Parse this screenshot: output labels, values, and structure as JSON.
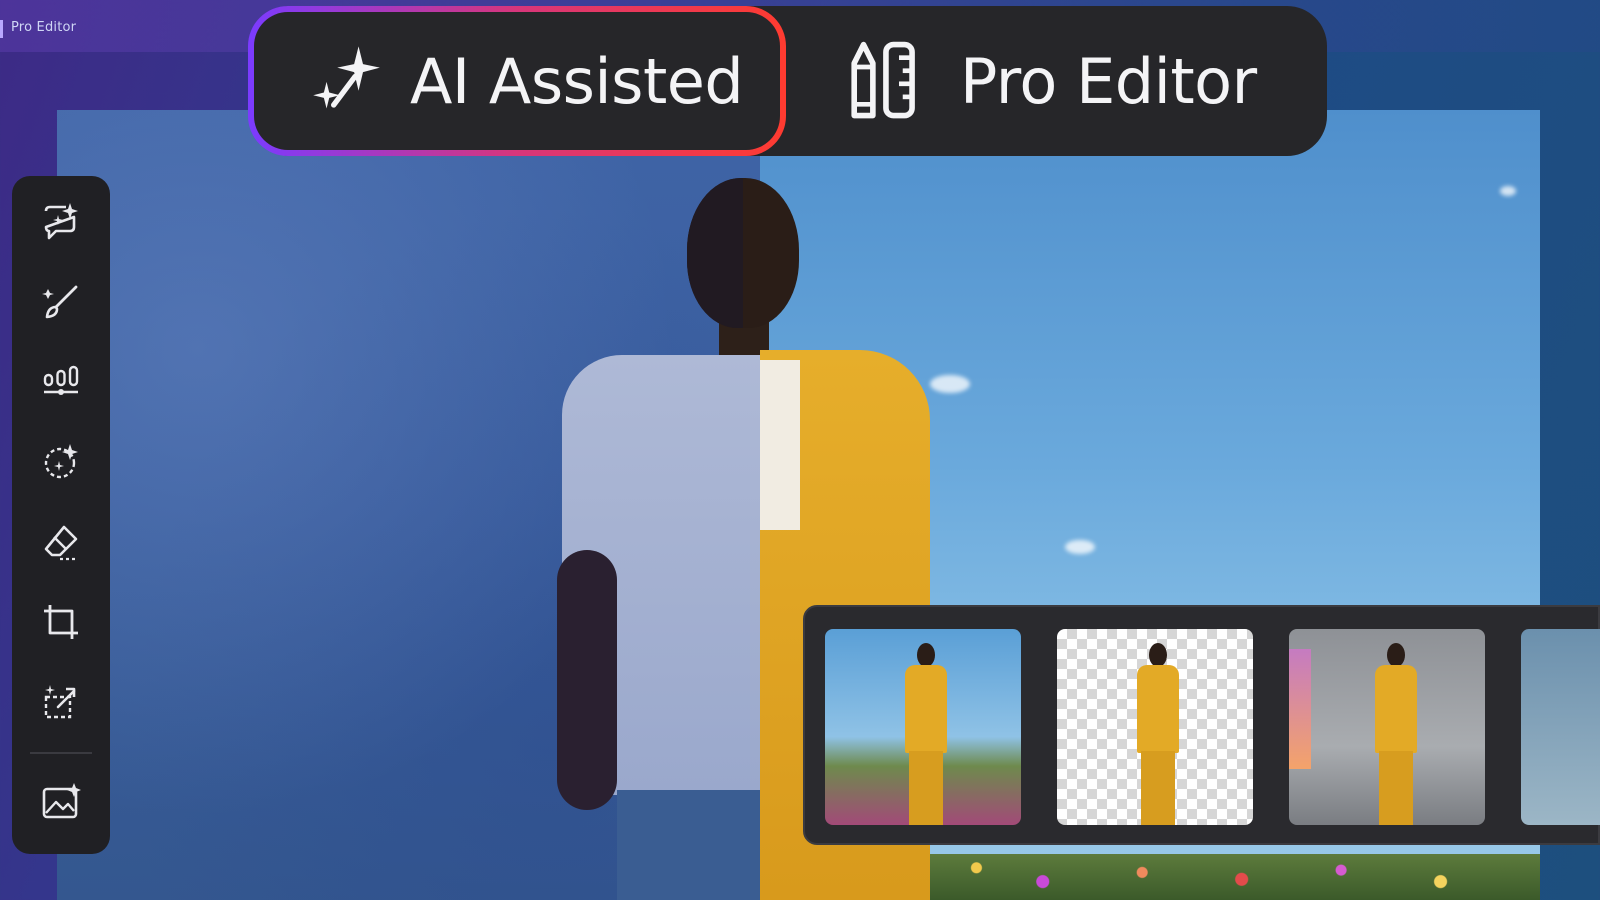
{
  "window": {
    "title": "Pro Editor"
  },
  "modes": {
    "ai_assisted": {
      "label": "AI Assisted",
      "icon": "sparkle-icon"
    },
    "pro_editor": {
      "label": "Pro Editor",
      "icon": "pencil-ruler-icon"
    },
    "active": "ai_assisted"
  },
  "toolbar": {
    "tools": [
      {
        "id": "ai-chat",
        "icon": "ai-chat-icon"
      },
      {
        "id": "brush",
        "icon": "brush-icon"
      },
      {
        "id": "adjust",
        "icon": "adjust-sliders-icon"
      },
      {
        "id": "ai-select",
        "icon": "ai-select-icon"
      },
      {
        "id": "erase",
        "icon": "eraser-icon"
      },
      {
        "id": "crop",
        "icon": "crop-icon"
      },
      {
        "id": "expand",
        "icon": "ai-expand-icon"
      },
      {
        "id": "generate-image",
        "icon": "ai-image-icon"
      }
    ]
  },
  "thumbnails": [
    {
      "id": "flower-field",
      "icon": "thumbnail"
    },
    {
      "id": "transparent-background",
      "icon": "thumbnail"
    },
    {
      "id": "concrete-room",
      "icon": "thumbnail"
    },
    {
      "id": "interior-partial",
      "icon": "thumbnail"
    }
  ],
  "colors": {
    "accent_gradient": [
      "#7b3bff",
      "#d7367b",
      "#ff3b30"
    ],
    "panel": "#262629",
    "toolbar": "#202024"
  }
}
